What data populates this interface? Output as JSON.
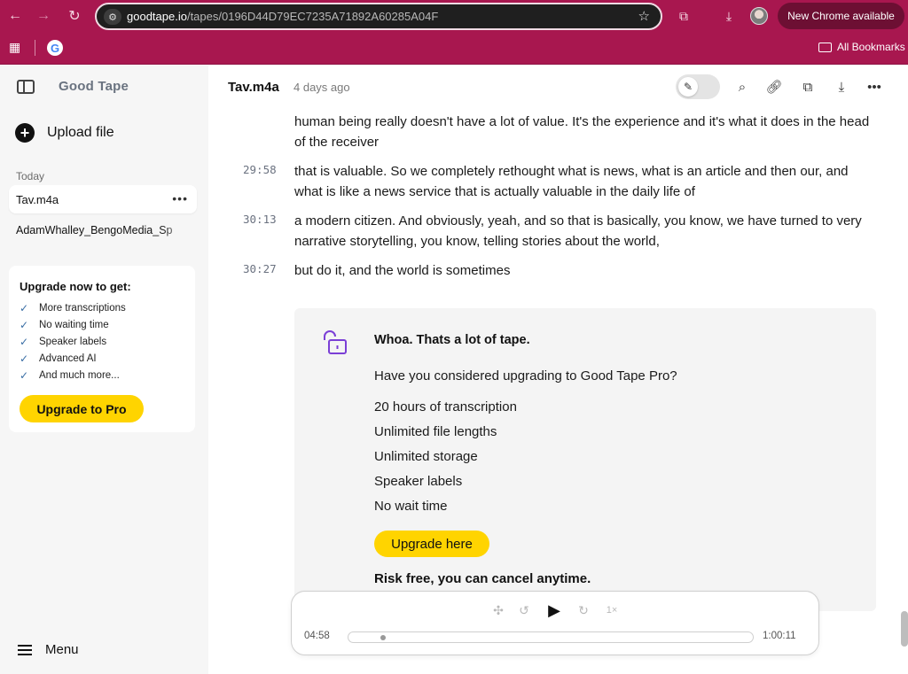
{
  "browser": {
    "url_host": "goodtape.io",
    "url_path": "/tapes/0196D44D79EC7235A71892A60285A04F",
    "update_label": "New Chrome available",
    "bookmarks_label": "All Bookmarks",
    "google_glyph": "G",
    "theme_color": "#a8174f"
  },
  "sidebar": {
    "brand": "Good Tape",
    "upload_label": "Upload file",
    "section_label": "Today",
    "files": [
      {
        "name": "Tav.m4a",
        "active": true
      },
      {
        "name": "AdamWhalley_BengoMedia_Sp",
        "active": false
      }
    ],
    "upgrade": {
      "title": "Upgrade now to get:",
      "benefits": [
        "More transcriptions",
        "No waiting time",
        "Speaker labels",
        "Advanced AI",
        "And much more..."
      ],
      "button_label": "Upgrade to Pro"
    },
    "menu_label": "Menu"
  },
  "topbar": {
    "filename": "Tav.m4a",
    "uploaded_ago": "4 days ago",
    "icons": [
      "edit-icon",
      "search-icon",
      "link-icon",
      "copy-icon",
      "download-icon",
      "more-icon"
    ]
  },
  "transcript": {
    "segments": [
      {
        "time": "",
        "text": "human being really doesn't have a lot of value. It's the experience and it's what it does in the head of the receiver"
      },
      {
        "time": "29:58",
        "text": "that is valuable. So we completely rethought what is news, what is an article and then our, and what is like a news service that is actually valuable in the daily life of"
      },
      {
        "time": "30:13",
        "text": "a modern citizen. And obviously, yeah, and so that is basically, you know, we have turned to very narrative storytelling, you know, telling stories about the world,"
      },
      {
        "time": "30:27",
        "text": "but do it, and the world is sometimes"
      }
    ]
  },
  "paywall": {
    "title": "Whoa. Thats a lot of tape.",
    "question": "Have you considered upgrading to Good Tape Pro?",
    "features": [
      "20 hours of transcription",
      "Unlimited file lengths",
      "Unlimited storage",
      "Speaker labels",
      "No wait time"
    ],
    "button_label": "Upgrade here",
    "footnote": "Risk free, you can cancel anytime.",
    "accent_color": "#7b3fd6"
  },
  "player": {
    "current_time": "04:58",
    "duration": "1:00:11",
    "speed": "1×",
    "progress_fraction": 0.08
  }
}
